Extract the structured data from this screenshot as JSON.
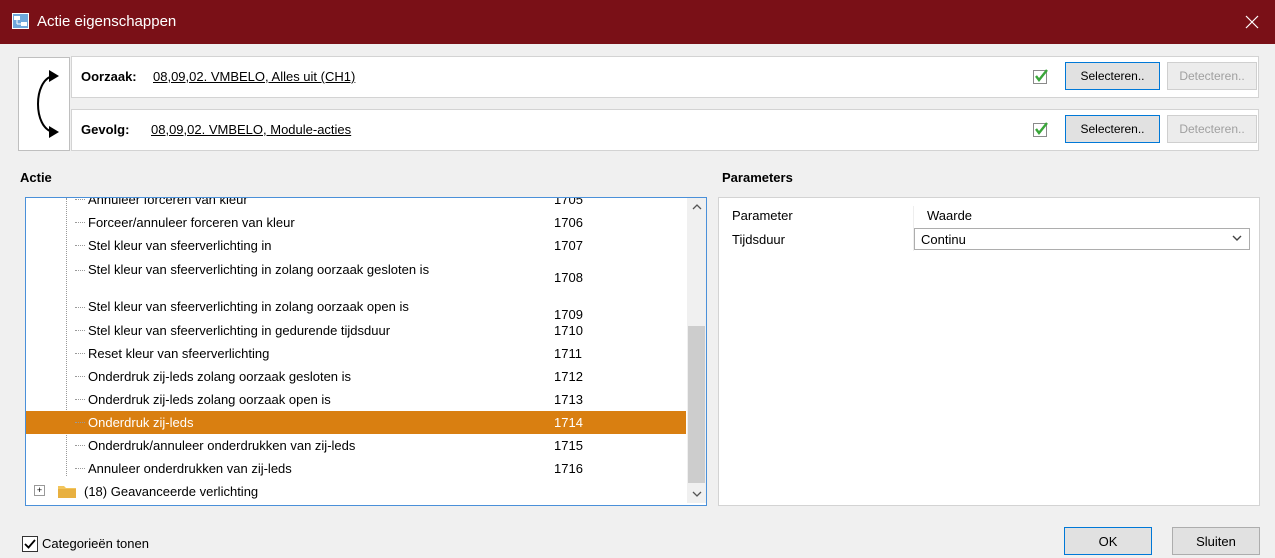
{
  "window": {
    "title": "Actie eigenschappen"
  },
  "cause": {
    "label": "Oorzaak:",
    "value": "08,09,02. VMBELO, Alles uit (CH1)",
    "select_label": "Selecteren..",
    "detect_label": "Detecteren.."
  },
  "effect": {
    "label": "Gevolg:",
    "value": "08,09,02. VMBELO, Module-acties",
    "select_label": "Selecteren..",
    "detect_label": "Detecteren.."
  },
  "action_section": {
    "title": "Actie"
  },
  "actions": [
    {
      "label": "Annuleer forceren van kleur",
      "id": "1705"
    },
    {
      "label": "Forceer/annuleer forceren van kleur",
      "id": "1706"
    },
    {
      "label": "Stel kleur van sfeerverlichting in",
      "id": "1707"
    },
    {
      "label": "Stel kleur van sfeerverlichting in zolang oorzaak gesloten is",
      "id": "1708"
    },
    {
      "label": "Stel kleur van sfeerverlichting in zolang oorzaak open is",
      "id": "1709"
    },
    {
      "label": "Stel kleur van sfeerverlichting in gedurende tijdsduur",
      "id": "1710"
    },
    {
      "label": "Reset kleur van sfeerverlichting",
      "id": "1711"
    },
    {
      "label": "Onderdruk zij-leds zolang oorzaak gesloten is",
      "id": "1712"
    },
    {
      "label": "Onderdruk zij-leds zolang oorzaak open is",
      "id": "1713"
    },
    {
      "label": "Onderdruk zij-leds",
      "id": "1714"
    },
    {
      "label": "Onderdruk/annuleer onderdrukken van zij-leds",
      "id": "1715"
    },
    {
      "label": "Annuleer onderdrukken van zij-leds",
      "id": "1716"
    }
  ],
  "selected_action": "1714",
  "category": {
    "label": "(18) Geavanceerde verlichting"
  },
  "parameters_section": {
    "title": "Parameters",
    "header_param": "Parameter",
    "header_value": "Waarde",
    "rows": [
      {
        "name": "Tijdsduur",
        "value": "Continu"
      }
    ]
  },
  "footer": {
    "show_categories_label": "Categorieën tonen",
    "show_categories_checked": true,
    "ok_label": "OK",
    "close_label": "Sluiten"
  },
  "colors": {
    "titlebar": "#7a1017",
    "selection": "#d97f11",
    "check_green": "#3aa63a"
  }
}
